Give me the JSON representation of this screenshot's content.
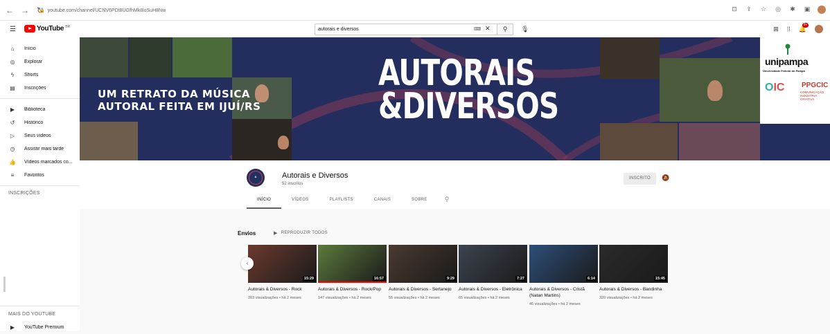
{
  "browser": {
    "url": "youtube.com/channel/UCNV6PDt8UGfhMk8loSuH8Nw",
    "back_icon": "arrow-left-icon",
    "forward_icon": "arrow-right-icon",
    "reload_icon": "reload-icon"
  },
  "header": {
    "logo_text": "YouTube",
    "logo_superscript": "BR",
    "search_value": "autorais e diversos",
    "notification_count": "9+"
  },
  "sidebar": {
    "items": [
      {
        "label": "Início",
        "icon": "home-icon"
      },
      {
        "label": "Explorar",
        "icon": "compass-icon"
      },
      {
        "label": "Shorts",
        "icon": "shorts-icon"
      },
      {
        "label": "Inscrições",
        "icon": "subscriptions-icon"
      },
      {
        "label": "Biblioteca",
        "icon": "library-icon"
      },
      {
        "label": "Histórico",
        "icon": "history-icon"
      },
      {
        "label": "Seus vídeos",
        "icon": "your-videos-icon"
      },
      {
        "label": "Assistir mais tarde",
        "icon": "watch-later-icon"
      },
      {
        "label": "Vídeos marcados co...",
        "icon": "thumbs-up-icon"
      },
      {
        "label": "Favoritos",
        "icon": "playlist-icon"
      }
    ],
    "subscriptions_heading": "INSCRIÇÕES",
    "more_heading": "MAIS DO YOUTUBE",
    "more_items": [
      {
        "label": "YouTube Premium",
        "icon": "youtube-premium-icon"
      }
    ]
  },
  "banner": {
    "tagline_line1": "UM RETRATO DA MÚSICA",
    "tagline_line2": "AUTORAL FEITA EM IJUÍ/RS",
    "title_line1": "AUTORAIS",
    "title_line2": "&DIVERSOS",
    "uni_name": "unipampa",
    "uni_sub": "Universidade Federal do Pampa",
    "ppg_name": "PPGCIC",
    "ppg_sub_line1": "COMUNICAÇÃO",
    "ppg_sub_line2": "INDÚSTRIA CRIATIVA"
  },
  "channel": {
    "name": "Autorais e Diversos",
    "subscribers": "52 inscritos",
    "subscribed_label": "INSCRITO",
    "tabs": [
      "INÍCIO",
      "VÍDEOS",
      "PLAYLISTS",
      "CANAIS",
      "SOBRE"
    ],
    "active_tab": "INÍCIO"
  },
  "shelf": {
    "title": "Envios",
    "play_all_label": "REPRODUZIR TODOS",
    "videos": [
      {
        "title": "Autorais & Diversos - Rock",
        "duration": "15:29",
        "meta": "203 visualizações • há 2 meses",
        "thumb_color": "#6b3a2e",
        "progress": 0
      },
      {
        "title": "Autorais & Diversos - Rock/Pop",
        "duration": "16:57",
        "meta": "147 visualizações • há 2 meses",
        "thumb_color": "#5c7a3c",
        "progress": 1
      },
      {
        "title": "Autorais & Diversos - Sertanejo",
        "duration": "9:29",
        "meta": "55 visualizações • há 2 meses",
        "thumb_color": "#4a3a30",
        "progress": 0
      },
      {
        "title": "Autorais & Diversos - Eletrônica",
        "duration": "7:27",
        "meta": "65 visualizações • há 2 meses",
        "thumb_color": "#3c4450",
        "progress": 0
      },
      {
        "title": "Autorais & Diversos - Cristã (Natan Martins)",
        "duration": "6:14",
        "meta": "46 visualizações • há 2 meses",
        "thumb_color": "#2d4f7a",
        "progress": 0
      },
      {
        "title": "Autorais & Diversos - Bandinha",
        "duration": "15:45",
        "meta": "320 visualizações • há 2 meses",
        "thumb_color": "#2a2a2a",
        "progress": 0
      }
    ]
  }
}
